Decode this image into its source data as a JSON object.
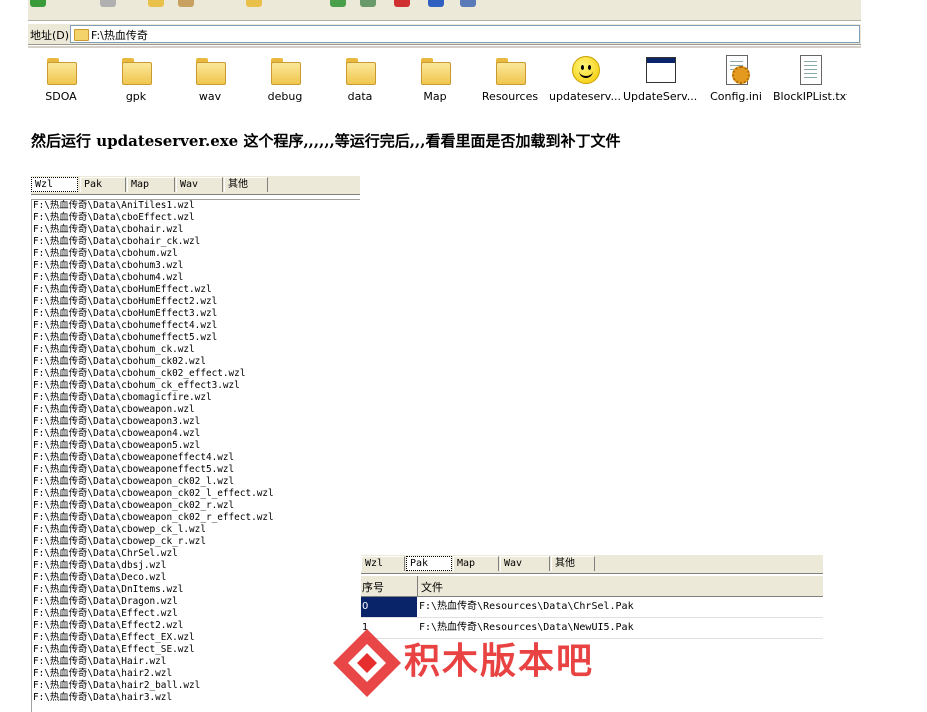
{
  "address": {
    "label": "地址(D)",
    "path": "F:\\热血传奇"
  },
  "icons": [
    {
      "label": "SDOA",
      "icon": "folder-icon"
    },
    {
      "label": "gpk",
      "icon": "folder-icon"
    },
    {
      "label": "wav",
      "icon": "folder-icon"
    },
    {
      "label": "debug",
      "icon": "folder-icon"
    },
    {
      "label": "data",
      "icon": "folder-icon"
    },
    {
      "label": "Map",
      "icon": "folder-icon"
    },
    {
      "label": "Resources",
      "icon": "folder-icon"
    },
    {
      "label": "updateserv...",
      "icon": "smiley-icon"
    },
    {
      "label": "UpdateServ...",
      "icon": "window-icon"
    },
    {
      "label": "Config.ini",
      "icon": "config-icon"
    },
    {
      "label": "BlockIPList.txt",
      "icon": "text-file-icon"
    }
  ],
  "heading": "然后运行 updateserver.exe 这个程序,,,,,,等运行完后,,,看看里面是否加载到补丁文件",
  "tabs_left": [
    "Wzl",
    "Pak",
    "Map",
    "Wav",
    "其他"
  ],
  "tabs_right": [
    "Wzl",
    "Pak",
    "Map",
    "Wav",
    "其他"
  ],
  "file_list": [
    "F:\\热血传奇\\Data\\AniTiles1.wzl",
    "F:\\热血传奇\\Data\\cboEffect.wzl",
    "F:\\热血传奇\\Data\\cbohair.wzl",
    "F:\\热血传奇\\Data\\cbohair_ck.wzl",
    "F:\\热血传奇\\Data\\cbohum.wzl",
    "F:\\热血传奇\\Data\\cbohum3.wzl",
    "F:\\热血传奇\\Data\\cbohum4.wzl",
    "F:\\热血传奇\\Data\\cboHumEffect.wzl",
    "F:\\热血传奇\\Data\\cboHumEffect2.wzl",
    "F:\\热血传奇\\Data\\cboHumEffect3.wzl",
    "F:\\热血传奇\\Data\\cbohumeffect4.wzl",
    "F:\\热血传奇\\Data\\cbohumeffect5.wzl",
    "F:\\热血传奇\\Data\\cbohum_ck.wzl",
    "F:\\热血传奇\\Data\\cbohum_ck02.wzl",
    "F:\\热血传奇\\Data\\cbohum_ck02_effect.wzl",
    "F:\\热血传奇\\Data\\cbohum_ck_effect3.wzl",
    "F:\\热血传奇\\Data\\cbomagicfire.wzl",
    "F:\\热血传奇\\Data\\cboweapon.wzl",
    "F:\\热血传奇\\Data\\cboweapon3.wzl",
    "F:\\热血传奇\\Data\\cboweapon4.wzl",
    "F:\\热血传奇\\Data\\cboweapon5.wzl",
    "F:\\热血传奇\\Data\\cboweaponeffect4.wzl",
    "F:\\热血传奇\\Data\\cboweaponeffect5.wzl",
    "F:\\热血传奇\\Data\\cboweapon_ck02_l.wzl",
    "F:\\热血传奇\\Data\\cboweapon_ck02_l_effect.wzl",
    "F:\\热血传奇\\Data\\cboweapon_ck02_r.wzl",
    "F:\\热血传奇\\Data\\cboweapon_ck02_r_effect.wzl",
    "F:\\热血传奇\\Data\\cbowep_ck_l.wzl",
    "F:\\热血传奇\\Data\\cbowep_ck_r.wzl",
    "F:\\热血传奇\\Data\\ChrSel.wzl",
    "F:\\热血传奇\\Data\\dbsj.wzl",
    "F:\\热血传奇\\Data\\Deco.wzl",
    "F:\\热血传奇\\Data\\DnItems.wzl",
    "F:\\热血传奇\\Data\\Dragon.wzl",
    "F:\\热血传奇\\Data\\Effect.wzl",
    "F:\\热血传奇\\Data\\Effect2.wzl",
    "F:\\热血传奇\\Data\\Effect_EX.wzl",
    "F:\\热血传奇\\Data\\Effect_SE.wzl",
    "F:\\热血传奇\\Data\\Hair.wzl",
    "F:\\热血传奇\\Data\\hair2.wzl",
    "F:\\热血传奇\\Data\\hair2_ball.wzl",
    "F:\\热血传奇\\Data\\hair3.wzl"
  ],
  "pak_table": {
    "headers": [
      "序号",
      "文件"
    ],
    "rows": [
      {
        "index": "0",
        "file": "F:\\热血传奇\\Resources\\Data\\ChrSel.Pak",
        "selected": true
      },
      {
        "index": "1",
        "file": "F:\\热血传奇\\Resources\\Data\\NewUI5.Pak",
        "selected": false
      }
    ]
  },
  "watermark": {
    "text": "积木版本吧",
    "color": "#e62e2e"
  }
}
